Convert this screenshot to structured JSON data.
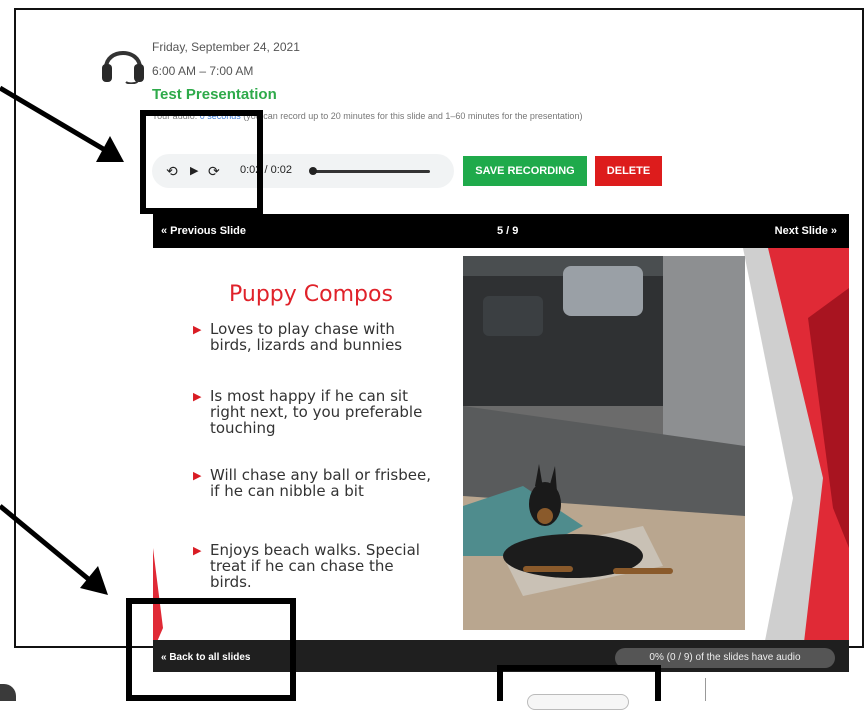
{
  "meeting": {
    "date": "Friday, September 24, 2021",
    "time": "6:00 AM – 7:00 AM",
    "title": "Test Presentation",
    "audio_prefix": "Your audio: ",
    "audio_value": "0 seconds",
    "audio_note": " (you can record up to 20 minutes for this slide and 1–60 minutes for the presentation)"
  },
  "player": {
    "rewind_icon": "⟲",
    "play_icon": "▶",
    "forward_icon": "⟳",
    "time": "0:02 / 0:02"
  },
  "actions": {
    "save_label": "SAVE RECORDING",
    "delete_label": "DELETE"
  },
  "viewer": {
    "prev_label": "« Previous Slide",
    "counter": "5 / 9",
    "next_label": "Next Slide »",
    "back_label": "« Back to all slides",
    "audio_status": "0% (0 / 9) of the slides have audio"
  },
  "slide": {
    "title": "Puppy Compos",
    "bullets": [
      {
        "text": "Loves to play chase with birds, lizards and bunnies"
      },
      {
        "text": "Is most happy if he can sit right next, to you preferable touching"
      },
      {
        "text": "Will chase any ball or frisbee, if he can nibble a bit"
      },
      {
        "text": "Enjoys beach walks. Special treat if he can chase the birds."
      }
    ]
  },
  "colors": {
    "accent_green": "#1faa4b",
    "title_green": "#2eaa4a",
    "delete_red": "#dd1c1c",
    "slide_red": "#e0222a",
    "link_blue": "#3b7bd6"
  }
}
